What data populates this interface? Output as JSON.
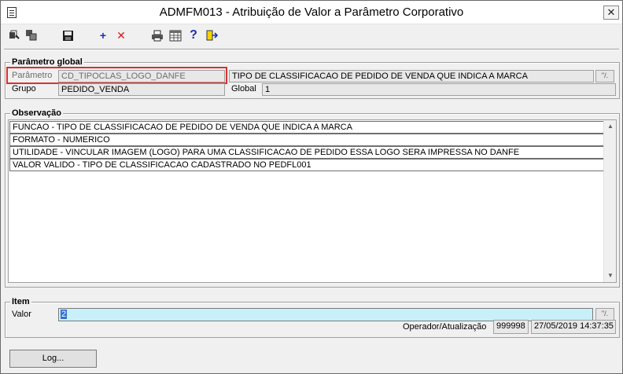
{
  "window": {
    "title": "ADMFM013 - Atribuição de Valor a Parâmetro Corporativo",
    "close_label": "✕"
  },
  "toolbar": {
    "icons": [
      "first-record-icon",
      "duplicate-icon",
      "save-icon",
      "add-icon",
      "delete-icon",
      "print-icon",
      "grid-icon",
      "help-icon",
      "exit-icon"
    ],
    "add_symbol": "+",
    "delete_symbol": "✕",
    "help_symbol": "?"
  },
  "parametro_global": {
    "section_title": "Parâmetro global",
    "parametro_label": "Parâmetro",
    "parametro_value": "CD_TIPOCLAS_LOGO_DANFE",
    "descricao_value": "TIPO DE CLASSIFICACAO DE PEDIDO DE VENDA QUE INDICA A MARCA",
    "lookup_label": "\"/.",
    "grupo_label": "Grupo",
    "grupo_value": "PEDIDO_VENDA",
    "global_label": "Global",
    "global_value": "1"
  },
  "observacao": {
    "section_title": "Observação",
    "lines": [
      "FUNCAO - TIPO DE CLASSIFICACAO DE PEDIDO DE VENDA QUE INDICA A MARCA",
      "FORMATO - NUMERICO",
      "UTILIDADE - VINCULAR IMAGEM (LOGO) PARA UMA CLASSIFICACAO DE PEDIDO ESSA LOGO SERA IMPRESSA NO DANFE",
      "VALOR VALIDO - TIPO DE CLASSIFICACAO CADASTRADO NO PEDFL001"
    ]
  },
  "item": {
    "section_title": "Item",
    "valor_label": "Valor",
    "valor_value": "2",
    "operador_label": "Operador/Atualização",
    "operador_value": "999998",
    "atualizacao_value": "27/05/2019 14:37:35"
  },
  "footer": {
    "log_button": "Log..."
  }
}
